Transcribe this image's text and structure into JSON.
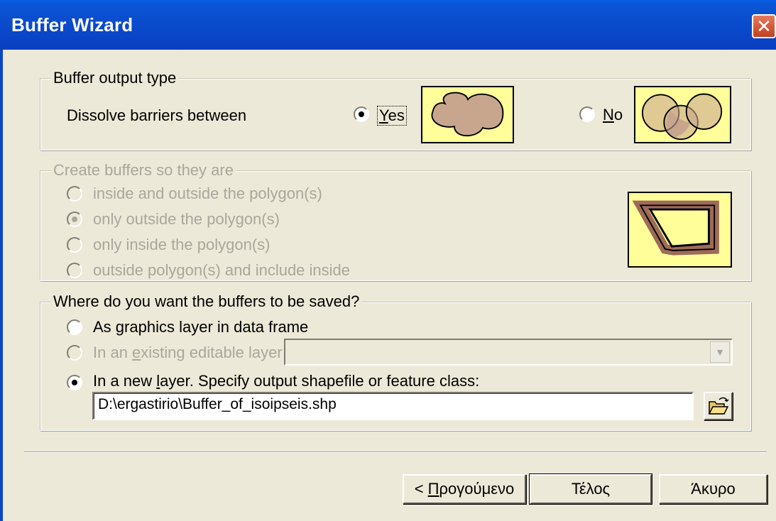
{
  "window": {
    "title": "Buffer Wizard",
    "close_glyph": "✕"
  },
  "output_type": {
    "legend": "Buffer output type",
    "dissolve_label": "Dissolve barriers between",
    "yes_label": "Yes",
    "no_label": "No",
    "selected": "Yes"
  },
  "create_buffers": {
    "legend": "Create buffers so they are",
    "options": [
      "inside and outside the polygon(s)",
      "only outside the polygon(s)",
      "only inside the polygon(s)",
      "outside polygon(s) and include inside"
    ],
    "selected_index": 1,
    "enabled": false
  },
  "save_location": {
    "legend": "Where do you want the buffers to be saved?",
    "graphics_label": "As graphics layer in data frame",
    "existing_label": "In an existing editable layer",
    "existing_value": "",
    "new_layer_label": "In a new layer.  Specify output shapefile or feature class:",
    "path_value": "D:\\ergastirio\\Buffer_of_isoipseis.shp",
    "selected": "new_layer"
  },
  "buttons": {
    "back": "< Προηγούμενο",
    "finish": "Τέλος",
    "cancel": "Άκυρο"
  },
  "colors": {
    "preview_bg": "#fffe99",
    "buffer_fill": "#c8a68e",
    "titlebar": "#0a46c8"
  }
}
